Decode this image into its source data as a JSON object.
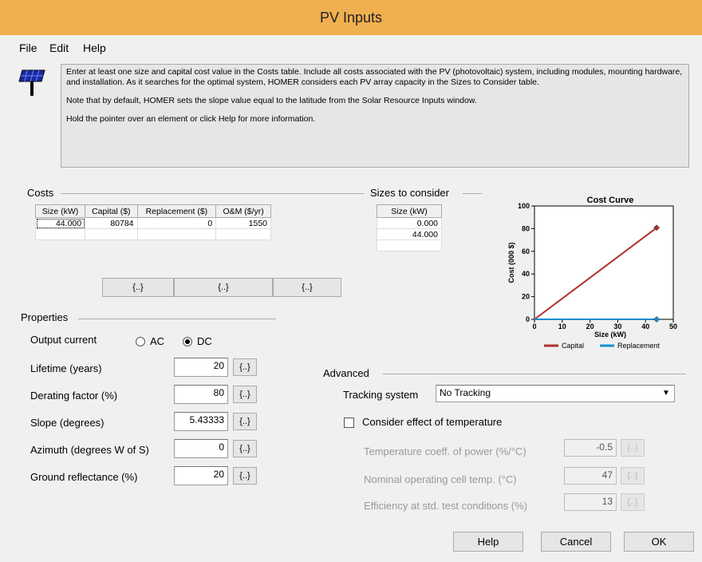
{
  "window": {
    "title": "PV Inputs"
  },
  "menu": [
    "File",
    "Edit",
    "Help"
  ],
  "info": {
    "p1": "Enter at least one size and capital cost value in the Costs table.  Include all costs associated with the PV (photovoltaic) system, including modules, mounting hardware, and installation. As it searches for the optimal system, HOMER considers each PV array capacity in the Sizes to Consider table.",
    "p2": "Note that by default, HOMER sets the slope value equal to the latitude from the Solar Resource Inputs window.",
    "p3": "Hold the pointer over an element or click Help for more information."
  },
  "costs": {
    "label": "Costs",
    "headers": [
      "Size (kW)",
      "Capital ($)",
      "Replacement ($)",
      "O&M ($/yr)"
    ],
    "rows": [
      [
        "44.000",
        "80784",
        "0",
        "1550"
      ]
    ],
    "button": "{..}"
  },
  "sizes": {
    "label": "Sizes to consider",
    "header": "Size (kW)",
    "values": [
      "0.000",
      "44.000"
    ]
  },
  "chart_data": {
    "type": "line",
    "title": "Cost Curve",
    "xlabel": "Size (kW)",
    "ylabel": "Cost (000 $)",
    "xlim": [
      0,
      50
    ],
    "ylim": [
      0,
      100
    ],
    "xticks": [
      0,
      10,
      20,
      30,
      40,
      50
    ],
    "yticks": [
      0,
      20,
      40,
      60,
      80,
      100
    ],
    "grid": false,
    "legend": "bottom",
    "series": [
      {
        "name": "Capital",
        "color": "#b03030",
        "x": [
          0,
          44
        ],
        "y": [
          0,
          80.784
        ]
      },
      {
        "name": "Replacement",
        "color": "#1a8fcf",
        "x": [
          0,
          44
        ],
        "y": [
          0,
          0
        ]
      }
    ]
  },
  "properties": {
    "label": "Properties",
    "output_current": "Output current",
    "ac": "AC",
    "dc": "DC",
    "selected": "DC",
    "fields": [
      {
        "label": "Lifetime (years)",
        "value": "20"
      },
      {
        "label": "Derating factor (%)",
        "value": "80"
      },
      {
        "label": "Slope (degrees)",
        "value": "5.43333"
      },
      {
        "label": "Azimuth (degrees W of S)",
        "value": "0"
      },
      {
        "label": "Ground reflectance (%)",
        "value": "20"
      }
    ],
    "sens": "{..}"
  },
  "advanced": {
    "label": "Advanced",
    "tracking_label": "Tracking system",
    "tracking_value": "No Tracking",
    "temp_check": "Consider effect of temperature",
    "fields": [
      {
        "label": "Temperature coeff. of power (%/°C)",
        "value": "-0.5"
      },
      {
        "label": "Nominal operating cell temp. (°C)",
        "value": "47"
      },
      {
        "label": "Efficiency at std. test conditions (%)",
        "value": "13"
      }
    ]
  },
  "buttons": {
    "help": "Help",
    "cancel": "Cancel",
    "ok": "OK"
  }
}
